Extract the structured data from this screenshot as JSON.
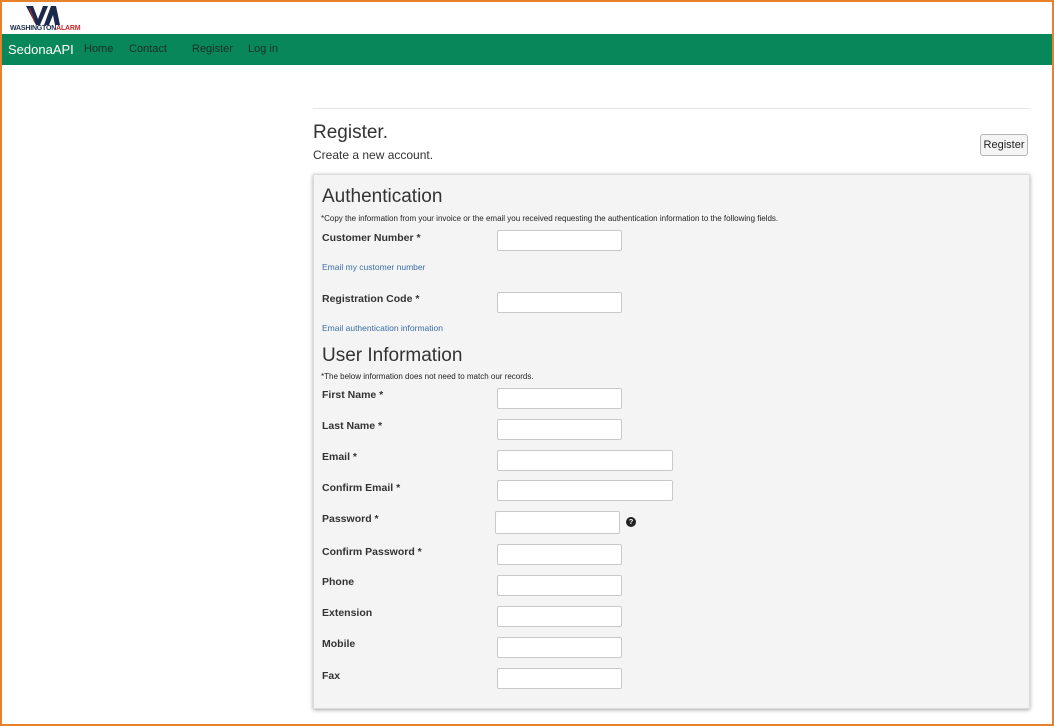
{
  "logo": {
    "word1": "WASHINGTON",
    "word2": "ALARM"
  },
  "nav": {
    "brand": "SedonaAPI",
    "links": [
      "Home",
      "Contact",
      "Register",
      "Log in"
    ]
  },
  "page": {
    "title": "Register.",
    "subtitle": "Create a new account.",
    "register_button": "Register"
  },
  "authentication": {
    "title": "Authentication",
    "note": "*Copy the information from your invoice or the email you received requesting the authentication information to the following fields.",
    "customer_number_label": "Customer Number *",
    "customer_number_value": "",
    "email_customer_number_link": "Email my customer number",
    "registration_code_label": "Registration Code *",
    "registration_code_value": "",
    "email_auth_link": "Email authentication information"
  },
  "user_info": {
    "title": "User Information",
    "note": "*The below information does not need to match our records.",
    "fields": {
      "first_name": "First Name *",
      "last_name": "Last Name *",
      "email": "Email *",
      "confirm_email": "Confirm Email *",
      "password": "Password *",
      "confirm_password": "Confirm Password *",
      "phone": "Phone",
      "extension": "Extension",
      "mobile": "Mobile",
      "fax": "Fax"
    },
    "password_help_icon": "?"
  },
  "colors": {
    "navbar": "#07875a",
    "frame": "#e8822a",
    "link": "#3a6ea5",
    "panel": "#f4f4f4",
    "logo_navy": "#1b2a4a",
    "logo_red": "#c8282a"
  },
  "icons": [
    "washington-alarm-logo",
    "question-circle-icon"
  ]
}
